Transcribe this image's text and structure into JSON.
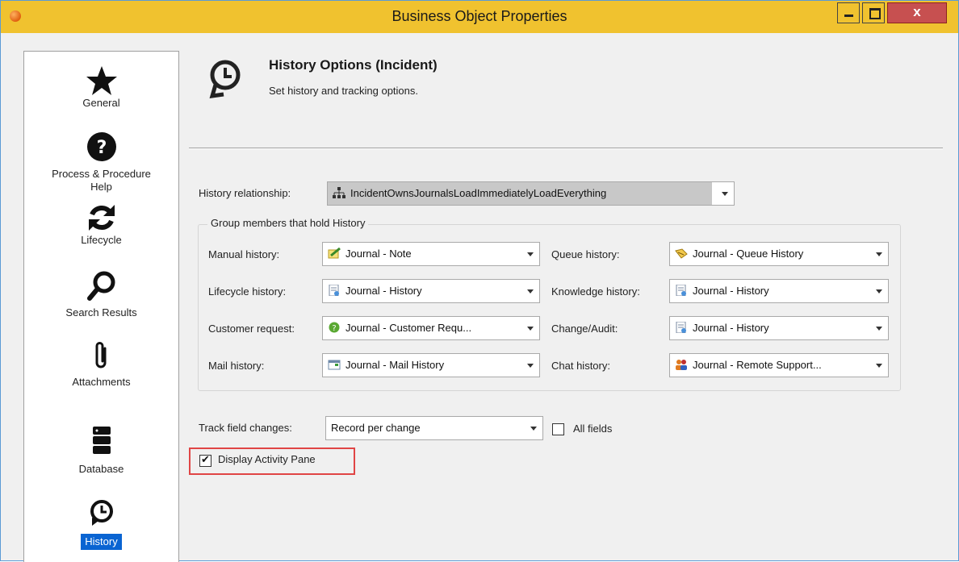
{
  "window": {
    "title": "Business Object Properties",
    "close_glyph": "x"
  },
  "sidebar": {
    "items": [
      {
        "label": "General",
        "icon": "star-icon"
      },
      {
        "label": "Process & Procedure Help",
        "icon": "question-icon"
      },
      {
        "label": "Lifecycle",
        "icon": "refresh-icon"
      },
      {
        "label": "Search Results",
        "icon": "search-icon"
      },
      {
        "label": "Attachments",
        "icon": "paperclip-icon"
      },
      {
        "label": "Database",
        "icon": "database-icon"
      },
      {
        "label": "History",
        "icon": "history-icon",
        "selected": true
      }
    ]
  },
  "header": {
    "title": "History Options  (Incident)",
    "subtitle": "Set history and tracking options."
  },
  "history_relationship": {
    "label": "History relationship:",
    "value": "IncidentOwnsJournalsLoadImmediatelyLoadEverything"
  },
  "group": {
    "title": "Group members that hold History",
    "fields": {
      "manual": {
        "label": "Manual history:",
        "value": "Journal - Note"
      },
      "lifecycle": {
        "label": "Lifecycle history:",
        "value": "Journal - History"
      },
      "customer": {
        "label": "Customer request:",
        "value": "Journal  -  Customer  Requ..."
      },
      "mail": {
        "label": "Mail history:",
        "value": "Journal - Mail History"
      },
      "queue": {
        "label": "Queue history:",
        "value": "Journal - Queue History"
      },
      "knowledge": {
        "label": "Knowledge history:",
        "value": "Journal - History"
      },
      "change": {
        "label": "Change/Audit:",
        "value": "Journal - History"
      },
      "chat": {
        "label": "Chat history:",
        "value": "Journal  -  Remote  Support..."
      }
    }
  },
  "track": {
    "label": "Track field changes:",
    "value": "Record per change",
    "all_fields_label": "All fields",
    "all_fields_checked": false
  },
  "activity_pane": {
    "label": "Display Activity Pane",
    "checked": true
  },
  "colors": {
    "title_bar": "#f0c22f",
    "close_button": "#c75050",
    "selection": "#0a64d2",
    "highlight_border": "#e04545"
  }
}
